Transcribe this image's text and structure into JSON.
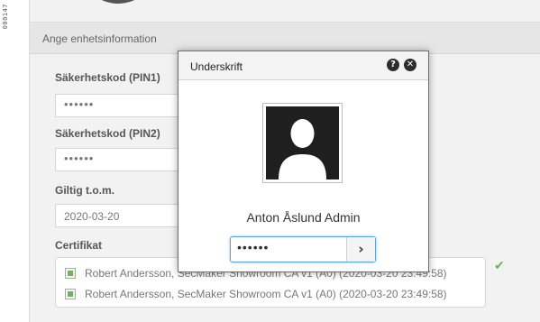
{
  "sidebar": {
    "page_number": "000147"
  },
  "section": {
    "title": "Ange enhetsinformation"
  },
  "fields": {
    "pin1": {
      "label": "Säkerhetskod (PIN1)",
      "value": "••••••"
    },
    "pin2": {
      "label": "Säkerhetskod (PIN2)",
      "value": "••••••"
    },
    "valid": {
      "label": "Giltig t.o.m.",
      "value": "2020-03-20"
    },
    "cert": {
      "label": "Certifikat",
      "items": [
        "Robert Andersson, SecMaker Showroom CA v1 (A0) (2020-03-20 23:49:58)",
        "Robert Andersson, SecMaker Showroom CA v1 (A0) (2020-03-20 23:49:58)"
      ]
    }
  },
  "modal": {
    "title": "Underskrift",
    "help_glyph": "?",
    "close_glyph": "✕",
    "user_name": "Anton Åslund Admin",
    "pin_value": "••••••",
    "submit_glyph": "›"
  },
  "icons": {
    "help": "help-icon",
    "close": "close-icon",
    "avatar": "user-silhouette-icon",
    "checkmark": "check-icon"
  },
  "colors": {
    "accent_blue": "#5aa2e8",
    "check_green": "#6cb55a",
    "avatar_dark": "#1f1f1f"
  }
}
